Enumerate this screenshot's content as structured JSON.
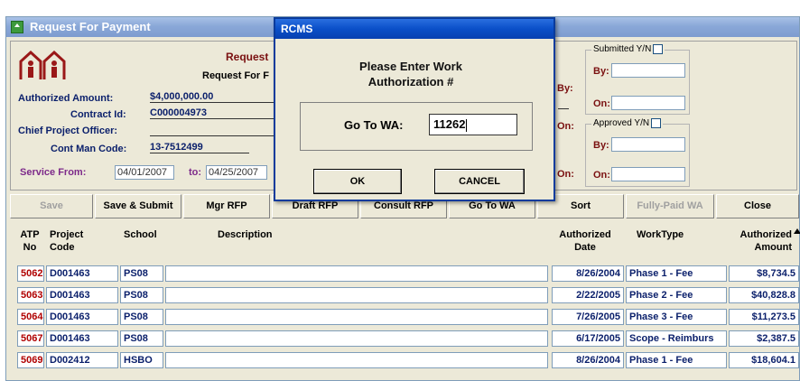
{
  "window": {
    "title": "Request For Payment"
  },
  "header": {
    "request_title": "Request",
    "request_subtitle": "Request For F",
    "authorized_amount_label": "Authorized Amount:",
    "authorized_amount": "$4,000,000.00",
    "contract_id_label": "Contract Id:",
    "contract_id": "C000004973",
    "chief_officer_label": "Chief Project Officer:",
    "cont_man_code_label": "Cont Man Code:",
    "cont_man_code": "13-7512499",
    "service_from_label": "Service From:",
    "service_from": "04/01/2007",
    "to_label": "to:",
    "service_to": "04/25/2007",
    "by_label": "By:",
    "on_label": "On:",
    "submitted_label": "Submitted Y/N",
    "approved_label": "Approved Y/N"
  },
  "toolbar": {
    "buttons": [
      "Save",
      "Save & Submit",
      "Mgr RFP",
      "Draft RFP",
      "Consult RFP",
      "Go To WA",
      "Sort",
      "Fully-Paid WA",
      "Close"
    ]
  },
  "table": {
    "headers": {
      "atp": [
        "ATP",
        "No"
      ],
      "project": [
        "Project",
        "Code"
      ],
      "school": "School",
      "description": "Description",
      "auth_date": [
        "Authorized",
        "Date"
      ],
      "worktype": "WorkType",
      "auth_amount": [
        "Authorized",
        "Amount"
      ]
    },
    "rows": [
      {
        "atp": "5062",
        "project": "D001463",
        "school": "PS08",
        "description": "",
        "date": "8/26/2004",
        "worktype": "Phase 1 - Fee",
        "amount": "$8,734.5"
      },
      {
        "atp": "5063",
        "project": "D001463",
        "school": "PS08",
        "description": "",
        "date": "2/22/2005",
        "worktype": "Phase 2 - Fee",
        "amount": "$40,828.8"
      },
      {
        "atp": "5064",
        "project": "D001463",
        "school": "PS08",
        "description": "",
        "date": "7/26/2005",
        "worktype": "Phase 3 - Fee",
        "amount": "$11,273.5"
      },
      {
        "atp": "5067",
        "project": "D001463",
        "school": "PS08",
        "description": "",
        "date": "6/17/2005",
        "worktype": "Scope - Reimburs",
        "amount": "$2,387.5"
      },
      {
        "atp": "5069",
        "project": "D002412",
        "school": "HSBO",
        "description": "",
        "date": "8/26/2004",
        "worktype": "Phase 1 - Fee",
        "amount": "$18,604.1"
      }
    ]
  },
  "dialog": {
    "title": "RCMS",
    "message_line1": "Please Enter Work",
    "message_line2": "Authorization #",
    "field_label": "Go To WA:",
    "field_value": "11262",
    "ok_label": "OK",
    "cancel_label": "CANCEL"
  },
  "colors": {
    "title_bar": "#8aa8d8",
    "dialog_title": "#0a4fc8",
    "atp_red": "#b00000",
    "text_navy": "#0a1f6b"
  }
}
